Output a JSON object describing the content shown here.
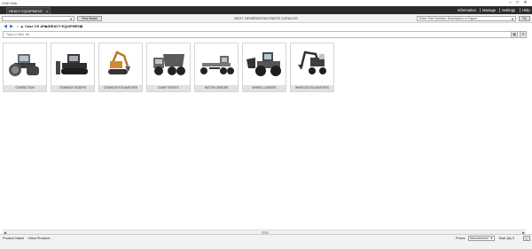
{
  "window": {
    "app_title": "CNH Hub",
    "minimize": "–",
    "maximize": "□",
    "close": "✕"
  },
  "topbar": {
    "tab_label": "HEAVY EQUIPMENT",
    "tab_close": "x",
    "menu": [
      "Information",
      "Manage",
      "Settings",
      "Help"
    ]
  },
  "toolbar": {
    "model_value": "",
    "model_arrow": "▼",
    "find_model_label": "Find Model",
    "center_title": "NEXT GENERATION PARTS CATALOG",
    "search_placeholder": "Enter Part Number, Description or Figure",
    "search_arrow": "▼",
    "search_button": "Go"
  },
  "navbar": {
    "back_icon": "◀",
    "forward_icon": "▶",
    "home_icon": "⌂",
    "breadcrumbs": [
      "Case CE APAC",
      "HEAVY EQUIPMENT"
    ],
    "sep": "▶"
  },
  "filter": {
    "placeholder": "Type to filter list"
  },
  "view_buttons": [
    "▦",
    "☰"
  ],
  "categories": [
    {
      "label": "COMPACTION",
      "icon": "roller-compactor-icon"
    },
    {
      "label": "CRAWLER DOZERS",
      "icon": "crawler-dozer-icon"
    },
    {
      "label": "CRAWLER EXCAVATORS",
      "icon": "crawler-excavator-icon"
    },
    {
      "label": "DUMP TRUCKS",
      "icon": "dump-truck-icon"
    },
    {
      "label": "MOTOR GRADER",
      "icon": "motor-grader-icon"
    },
    {
      "label": "WHEEL LOADERS",
      "icon": "wheel-loader-icon"
    },
    {
      "label": "WHEELED EXCAVATORS",
      "icon": "wheeled-excavator-icon"
    }
  ],
  "scroll": {
    "left": "◀",
    "right": "▶",
    "grip": "···"
  },
  "statusbar": {
    "product_name_label": "Product Name",
    "product_name_value": "<New Product>",
    "prices_label": "Prices",
    "prices_value": "Manufacturer",
    "prices_arrow": "▼",
    "total_qty": "Total Qty 0",
    "cart_icon": "🛒"
  }
}
